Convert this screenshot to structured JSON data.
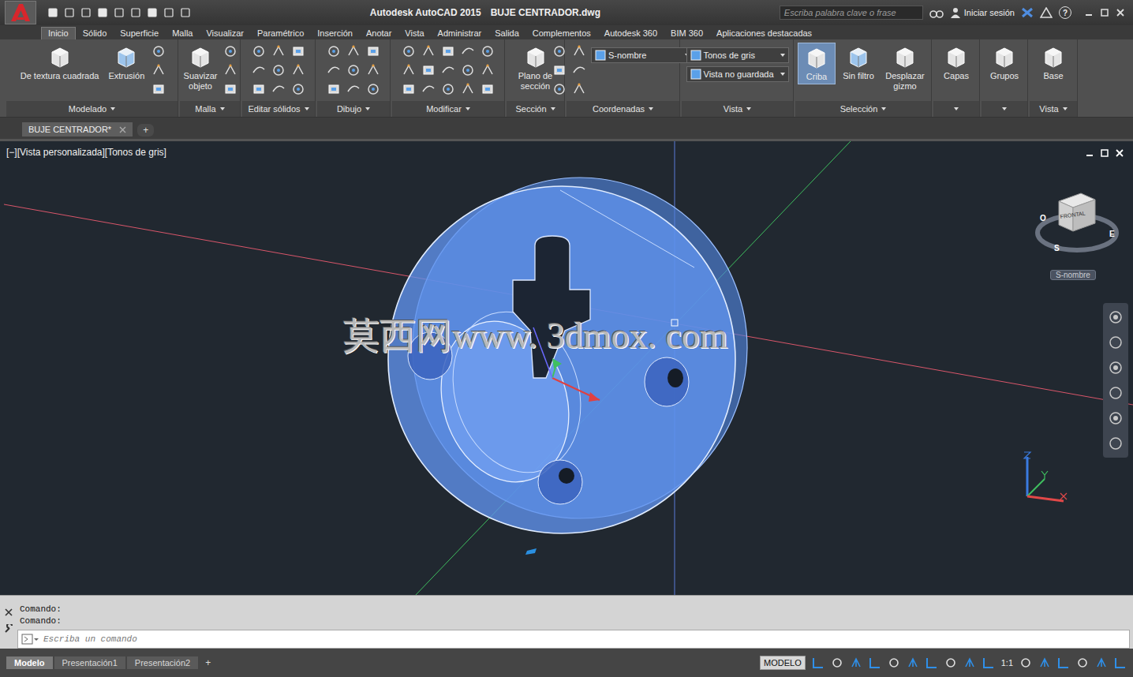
{
  "app": {
    "title": "Autodesk AutoCAD 2015",
    "file": "BUJE CENTRADOR.dwg",
    "search_placeholder": "Escriba palabra clave o frase",
    "sign_in": "Iniciar sesión",
    "help": "?"
  },
  "menu_tabs": [
    {
      "label": "Inicio",
      "selected": true
    },
    {
      "label": "Sólido",
      "selected": false
    },
    {
      "label": "Superficie",
      "selected": false
    },
    {
      "label": "Malla",
      "selected": false
    },
    {
      "label": "Visualizar",
      "selected": false
    },
    {
      "label": "Paramétrico",
      "selected": false
    },
    {
      "label": "Inserción",
      "selected": false
    },
    {
      "label": "Anotar",
      "selected": false
    },
    {
      "label": "Vista",
      "selected": false
    },
    {
      "label": "Administrar",
      "selected": false
    },
    {
      "label": "Salida",
      "selected": false
    },
    {
      "label": "Complementos",
      "selected": false
    },
    {
      "label": "Autodesk 360",
      "selected": false
    },
    {
      "label": "BIM 360",
      "selected": false
    },
    {
      "label": "Aplicaciones destacadas",
      "selected": false
    }
  ],
  "ribbon_panels": [
    {
      "label": "Modelado",
      "buttons": [
        {
          "label": "De textura cuadrada",
          "selected": false
        },
        {
          "label": "Extrusión",
          "selected": false
        }
      ],
      "dropdowns": []
    },
    {
      "label": "Malla",
      "buttons": [
        {
          "label": "Suavizar objeto",
          "selected": false
        }
      ],
      "dropdowns": []
    },
    {
      "label": "Editar sólidos",
      "buttons": [],
      "dropdowns": []
    },
    {
      "label": "Dibujo",
      "buttons": [],
      "dropdowns": []
    },
    {
      "label": "Modificar",
      "buttons": [],
      "dropdowns": []
    },
    {
      "label": "Sección",
      "buttons": [
        {
          "label": "Plano de sección",
          "selected": false
        }
      ],
      "dropdowns": []
    },
    {
      "label": "Coordenadas",
      "buttons": [],
      "dropdowns": [
        "S-nombre"
      ]
    },
    {
      "label": "Vista",
      "buttons": [],
      "dropdowns": [
        "Tonos de gris",
        "Vista no guardada"
      ]
    },
    {
      "label": "Selección",
      "buttons": [
        {
          "label": "Criba",
          "selected": true
        },
        {
          "label": "Sin filtro",
          "selected": false
        },
        {
          "label": "Desplazar gizmo",
          "selected": false
        }
      ],
      "dropdowns": []
    },
    {
      "label": "",
      "buttons": [
        {
          "label": "Capas",
          "selected": false
        }
      ],
      "dropdowns": []
    },
    {
      "label": "",
      "buttons": [
        {
          "label": "Grupos",
          "selected": false
        }
      ],
      "dropdowns": []
    },
    {
      "label": "Vista",
      "buttons": [
        {
          "label": "Base",
          "selected": false
        }
      ],
      "dropdowns": []
    }
  ],
  "document_tabs": [
    {
      "label": "BUJE CENTRADOR*",
      "selected": true
    }
  ],
  "new_tab": "+",
  "viewport": {
    "label": "[−][Vista personalizada][Tonos de gris]",
    "viewcube_face": "FRONTAL",
    "compass": [
      "O",
      "E",
      "S"
    ],
    "ucs_name": "S-nombre",
    "watermark": "莫西网www. 3dmox. com"
  },
  "command": {
    "history": [
      "Comando:",
      "Comando:"
    ],
    "placeholder": "Escriba un comando"
  },
  "layout_tabs": [
    {
      "label": "Modelo",
      "selected": true
    },
    {
      "label": "Presentación1",
      "selected": false
    },
    {
      "label": "Presentación2",
      "selected": false
    }
  ],
  "layout_new": "+",
  "status_bar": {
    "space": "MODELO",
    "scale": "1:1"
  }
}
